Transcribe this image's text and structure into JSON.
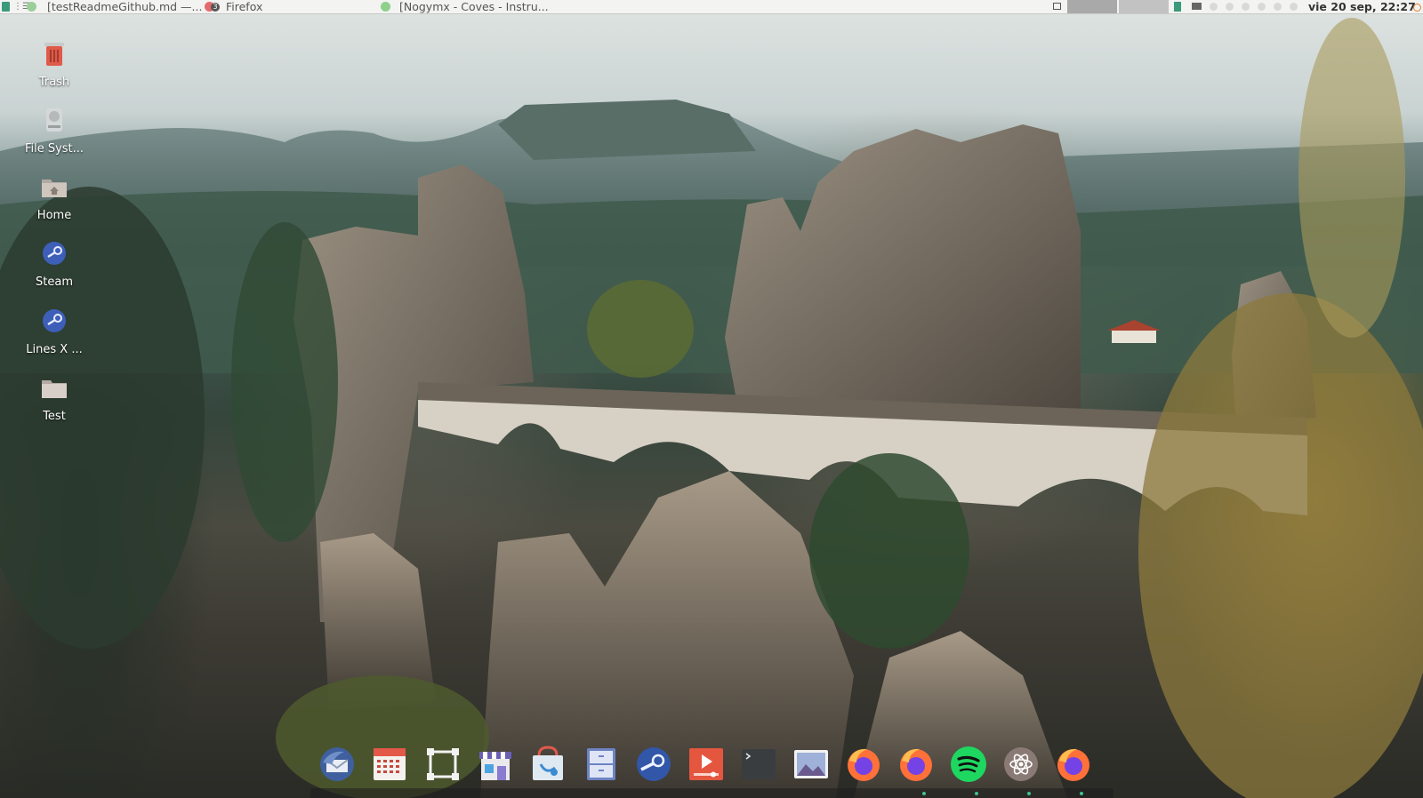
{
  "top_panel": {
    "windows": [
      {
        "title": "[testReadmeGithub.md —...",
        "icon": "text-editor-icon"
      },
      {
        "title": "Firefox",
        "icon": "firefox-icon",
        "badge": "3"
      },
      {
        "title": "[Nogymx - Coves - Instru...",
        "icon": "spotify-icon"
      }
    ],
    "clock": "vie 20 sep, 22:27"
  },
  "desktop_icons": [
    {
      "label": "Trash",
      "icon": "trash-icon"
    },
    {
      "label": "File Syst...",
      "icon": "drive-icon"
    },
    {
      "label": "Home",
      "icon": "home-folder-icon"
    },
    {
      "label": "Steam",
      "icon": "steam-icon"
    },
    {
      "label": "Lines X ...",
      "icon": "steam-game-icon"
    },
    {
      "label": "Test",
      "icon": "folder-icon"
    }
  ],
  "dock": [
    {
      "name": "Thunderbird",
      "icon": "mail-client-icon"
    },
    {
      "name": "Calendar",
      "icon": "calendar-icon"
    },
    {
      "name": "Screenshot",
      "icon": "screenshot-icon"
    },
    {
      "name": "Store",
      "icon": "store-icon"
    },
    {
      "name": "Package Installer",
      "icon": "package-icon"
    },
    {
      "name": "Files",
      "icon": "file-manager-icon"
    },
    {
      "name": "Steam",
      "icon": "steam-icon"
    },
    {
      "name": "Video Player",
      "icon": "video-player-icon"
    },
    {
      "name": "Terminal",
      "icon": "terminal-icon"
    },
    {
      "name": "Image Viewer",
      "icon": "image-viewer-icon"
    },
    {
      "name": "Firefox",
      "icon": "firefox-icon"
    },
    {
      "name": "Firefox",
      "icon": "firefox-icon"
    },
    {
      "name": "Spotify",
      "icon": "spotify-icon"
    },
    {
      "name": "Settings",
      "icon": "atom-settings-icon"
    },
    {
      "name": "Firefox",
      "icon": "firefox-icon"
    }
  ],
  "colors": {
    "panel": "#f3f3f1",
    "accent": "#3b9a7b",
    "spotify": "#1ed760",
    "firefox": "#ff7139"
  }
}
